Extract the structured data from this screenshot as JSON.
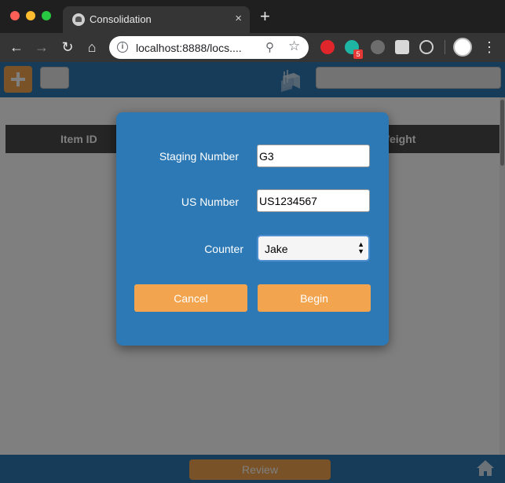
{
  "browser": {
    "tab_title": "Consolidation",
    "tab_close": "×",
    "new_tab": "+",
    "url": "localhost:8888/locs....",
    "icons": {
      "back": "back-arrow-icon",
      "forward": "forward-arrow-icon",
      "reload": "reload-icon",
      "home": "home-icon",
      "info": "info-icon",
      "zoom": "zoom-icon",
      "star": "bookmark-star-icon",
      "menu": "more-menu-icon"
    },
    "extension_badge": "5"
  },
  "app": {
    "colors": {
      "primary": "#2d79b5",
      "accent": "#f2a44e",
      "table_header": "#4a4a4a"
    },
    "table": {
      "columns": [
        "Item ID",
        "Weight"
      ]
    },
    "footer": {
      "review_label": "Review"
    }
  },
  "modal": {
    "staging_label": "Staging Number",
    "staging_value": "G3",
    "us_label": "US Number",
    "us_value": "US1234567",
    "counter_label": "Counter",
    "counter_value": "Jake",
    "cancel_label": "Cancel",
    "begin_label": "Begin"
  }
}
